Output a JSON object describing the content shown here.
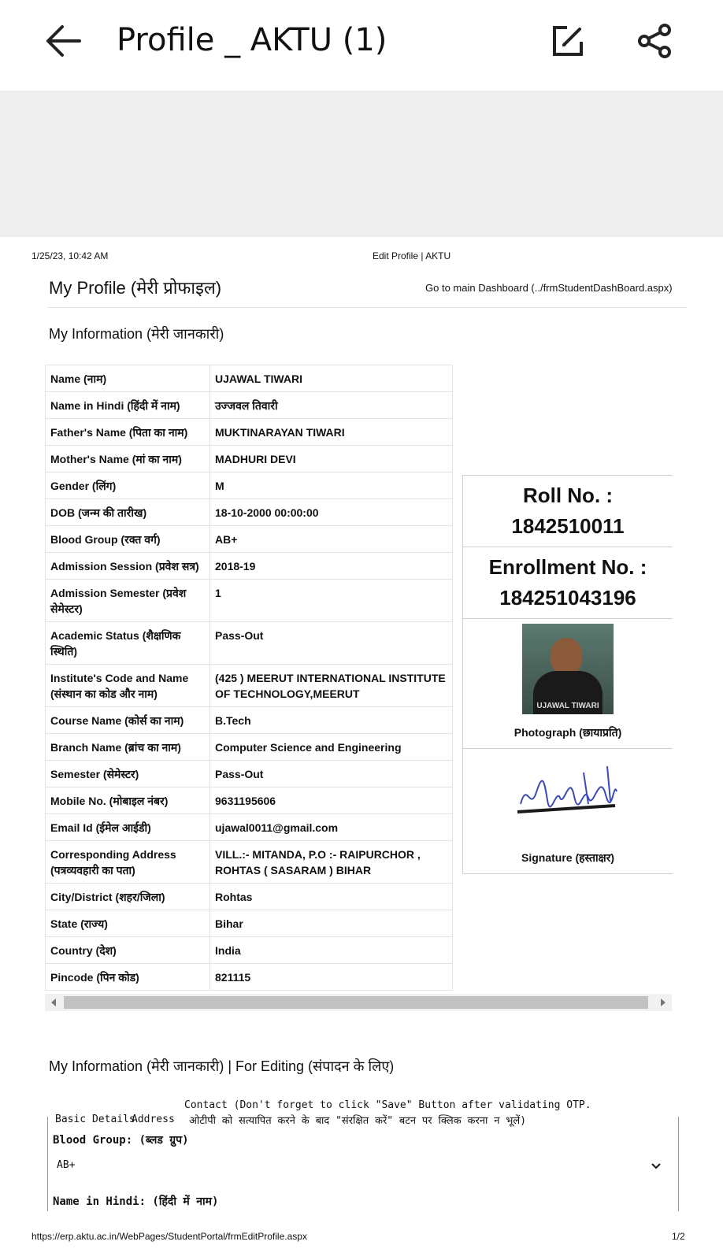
{
  "appbar": {
    "title": "Profile _ AKTU (1)"
  },
  "print_header": {
    "datetime": "1/25/23, 10:42 AM",
    "page_title": "Edit Profile | AKTU"
  },
  "page": {
    "heading": "My Profile (मेरी प्रोफाइल)",
    "dashboard_link": "Go to main Dashboard (../frmStudentDashBoard.aspx)",
    "section_title": "My Information (मेरी जानकारी)"
  },
  "info_rows": [
    {
      "label": "Name (नाम)",
      "value": "UJAWAL TIWARI"
    },
    {
      "label": "Name in Hindi (हिंदी में नाम)",
      "value": "उज्जवल तिवारी"
    },
    {
      "label": "Father's Name (पिता का नाम)",
      "value": "MUKTINARAYAN TIWARI"
    },
    {
      "label": "Mother's Name (मां का नाम)",
      "value": "MADHURI DEVI"
    },
    {
      "label": "Gender (लिंग)",
      "value": "M"
    },
    {
      "label": "DOB (जन्म की तारीख)",
      "value": "18-10-2000 00:00:00"
    },
    {
      "label": "Blood Group (रक्त वर्ग)",
      "value": "AB+"
    },
    {
      "label": "Admission Session (प्रवेश सत्र)",
      "value": "2018-19"
    },
    {
      "label": "Admission Semester (प्रवेश सेमेस्टर)",
      "value": "1"
    },
    {
      "label": "Academic Status (शैक्षणिक स्थिति)",
      "value": "Pass-Out"
    },
    {
      "label": "Institute's Code and Name (संस्थान का कोड और नाम)",
      "value": "(425 ) MEERUT INTERNATIONAL INSTITUTE OF TECHNOLOGY,MEERUT"
    },
    {
      "label": "Course Name (कोर्स का नाम)",
      "value": "B.Tech"
    },
    {
      "label": "Branch Name (ब्रांच का नाम)",
      "value": "Computer Science and Engineering"
    },
    {
      "label": "Semester (सेमेस्टर)",
      "value": "Pass-Out"
    },
    {
      "label": "Mobile No. (मोबाइल नंबर)",
      "value": "9631195606"
    },
    {
      "label": "Email Id (ईमेल आईडी)",
      "value": "ujawal0011@gmail.com"
    },
    {
      "label": "Corresponding Address (पत्रव्यवहारी का पता)",
      "value": "VILL.:- MITANDA, P.O :- RAIPURCHOR , ROHTAS ( SASARAM ) BIHAR"
    },
    {
      "label": "City/District (शहर/जिला)",
      "value": "Rohtas"
    },
    {
      "label": "State (राज्य)",
      "value": "Bihar"
    },
    {
      "label": "Country (देश)",
      "value": "India"
    },
    {
      "label": "Pincode (पिन कोड)",
      "value": "821115"
    }
  ],
  "side_panel": {
    "roll_label": "Roll No. :",
    "roll_no": "1842510011",
    "enrollment_label": "Enrollment No. :",
    "enrollment_no": "184251043196",
    "photo_caption": "Photograph (छायाप्रति)",
    "photo_name_tag": "UJAWAL TIWARI",
    "signature_caption": "Signature (हस्ताक्षर)"
  },
  "editing": {
    "section_title": "My Information (मेरी जानकारी) | For Editing (संपादन के लिए)",
    "tab_basic": "Basic Details",
    "tab_address": "Address",
    "tab_contact": "Contact (Don't forget to click \"Save\" Button after validating OTP.",
    "contact_hindi": "ओटीपी को सत्यापित करने के बाद \"संरक्षित करें\" बटन पर क्लिक करना न भूलें)",
    "blood_group_label": "Blood Group: (ब्लड ग्रुप)",
    "blood_group_value": "AB+",
    "name_hindi_label": "Name in Hindi: (हिंदी में नाम)"
  },
  "print_footer": {
    "url": "https://erp.aktu.ac.in/WebPages/StudentPortal/frmEditProfile.aspx",
    "page_no": "1/2"
  }
}
